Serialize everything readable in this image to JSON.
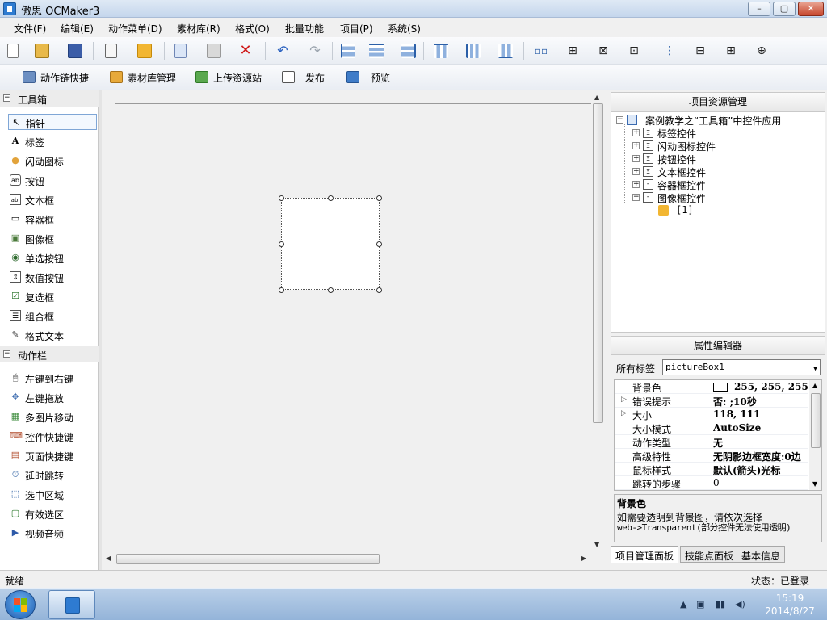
{
  "window": {
    "title": "傲思 OCMaker3",
    "minimize_label": "–",
    "maximize_label": "▢",
    "close_label": "✕"
  },
  "menu": [
    "文件(F)",
    "编辑(E)",
    "动作菜单(D)",
    "素材库(R)",
    "格式(O)",
    "批量功能",
    "项目(P)",
    "系统(S)"
  ],
  "toolbar_icons": [
    "new-file-icon",
    "open-folder-icon",
    "save-icon",
    "properties-icon",
    "puzzle-icon",
    "copy-icon",
    "paste-icon",
    "delete-icon",
    "undo-icon",
    "redo-icon",
    "align-left-icon",
    "align-center-icon",
    "align-right-icon",
    "align-top-icon",
    "align-middle-icon",
    "align-bottom-icon",
    "distribute-h-icon",
    "space-h-icon",
    "equal-width-icon",
    "equal-height-icon",
    "distribute-v-icon",
    "space-v-icon",
    "same-size-icon",
    "center-icon"
  ],
  "toolbar2": [
    {
      "label": "动作链快捷",
      "icon": "action-chain-icon"
    },
    {
      "label": "素材库管理",
      "icon": "library-icon"
    },
    {
      "label": "上传资源站",
      "icon": "upload-icon"
    },
    {
      "label": "发布",
      "icon": "publish-icon"
    },
    {
      "label": "预览",
      "icon": "preview-icon"
    }
  ],
  "toolbox": {
    "section1": "工具箱",
    "tools": [
      {
        "label": "指针",
        "glyph": "↖"
      },
      {
        "label": "标签",
        "glyph": "A"
      },
      {
        "label": "闪动图标",
        "glyph": "●"
      },
      {
        "label": "按钮",
        "glyph": "ab"
      },
      {
        "label": "文本框",
        "glyph": "abl"
      },
      {
        "label": "容器框",
        "glyph": "▭"
      },
      {
        "label": "图像框",
        "glyph": "▣"
      },
      {
        "label": "单选按钮",
        "glyph": "◉"
      },
      {
        "label": "数值按钮",
        "glyph": "⇕"
      },
      {
        "label": "复选框",
        "glyph": "☑"
      },
      {
        "label": "组合框",
        "glyph": "☰"
      },
      {
        "label": "格式文本",
        "glyph": "✎"
      }
    ],
    "section2": "动作栏",
    "actions": [
      {
        "label": "左键到右键",
        "glyph": "🖱"
      },
      {
        "label": "左键拖放",
        "glyph": "✥"
      },
      {
        "label": "多图片移动",
        "glyph": "▦"
      },
      {
        "label": "控件快捷键",
        "glyph": "⌨"
      },
      {
        "label": "页面快捷键",
        "glyph": "▤"
      },
      {
        "label": "延时跳转",
        "glyph": "⏱"
      },
      {
        "label": "选中区域",
        "glyph": "⬚"
      },
      {
        "label": "有效选区",
        "glyph": "▢"
      },
      {
        "label": "视频音频",
        "glyph": "▶"
      }
    ]
  },
  "project_panel": {
    "title": "项目资源管理",
    "root": "案例教学之“工具箱”中控件应用",
    "children": [
      "标签控件",
      "闪动图标控件",
      "按钮控件",
      "文本框控件",
      "容器框控件",
      "图像框控件"
    ],
    "leaf": "[1]"
  },
  "property_panel": {
    "title": "属性编辑器",
    "tag_label": "所有标签",
    "selected": "pictureBox1",
    "rows": [
      {
        "key": "背景色",
        "value": "255, 255, 255",
        "swatch": "#ffffff"
      },
      {
        "key": "错误提示",
        "value": "否: ;10秒",
        "expand": true
      },
      {
        "key": "大小",
        "value": "118, 111",
        "expand": true
      },
      {
        "key": "大小模式",
        "value": "AutoSize"
      },
      {
        "key": "动作类型",
        "value": "无"
      },
      {
        "key": "高级特性",
        "value": "无阴影边框宽度:0边"
      },
      {
        "key": "鼠标样式",
        "value": "默认(箭头)光标"
      },
      {
        "key": "跳转的步骤",
        "value": "0"
      }
    ],
    "desc_title": "背景色",
    "desc_line1": "如需要透明到背景图，请依次选择",
    "desc_line2": "web->Transparent(部分控件无法使用透明)"
  },
  "bottom_tabs": [
    "项目管理面板",
    "技能点面板",
    "基本信息"
  ],
  "status": {
    "left": "就绪",
    "right": "状态：已登录"
  },
  "taskbar": {
    "time": "15:19",
    "date": "2014/8/27"
  }
}
